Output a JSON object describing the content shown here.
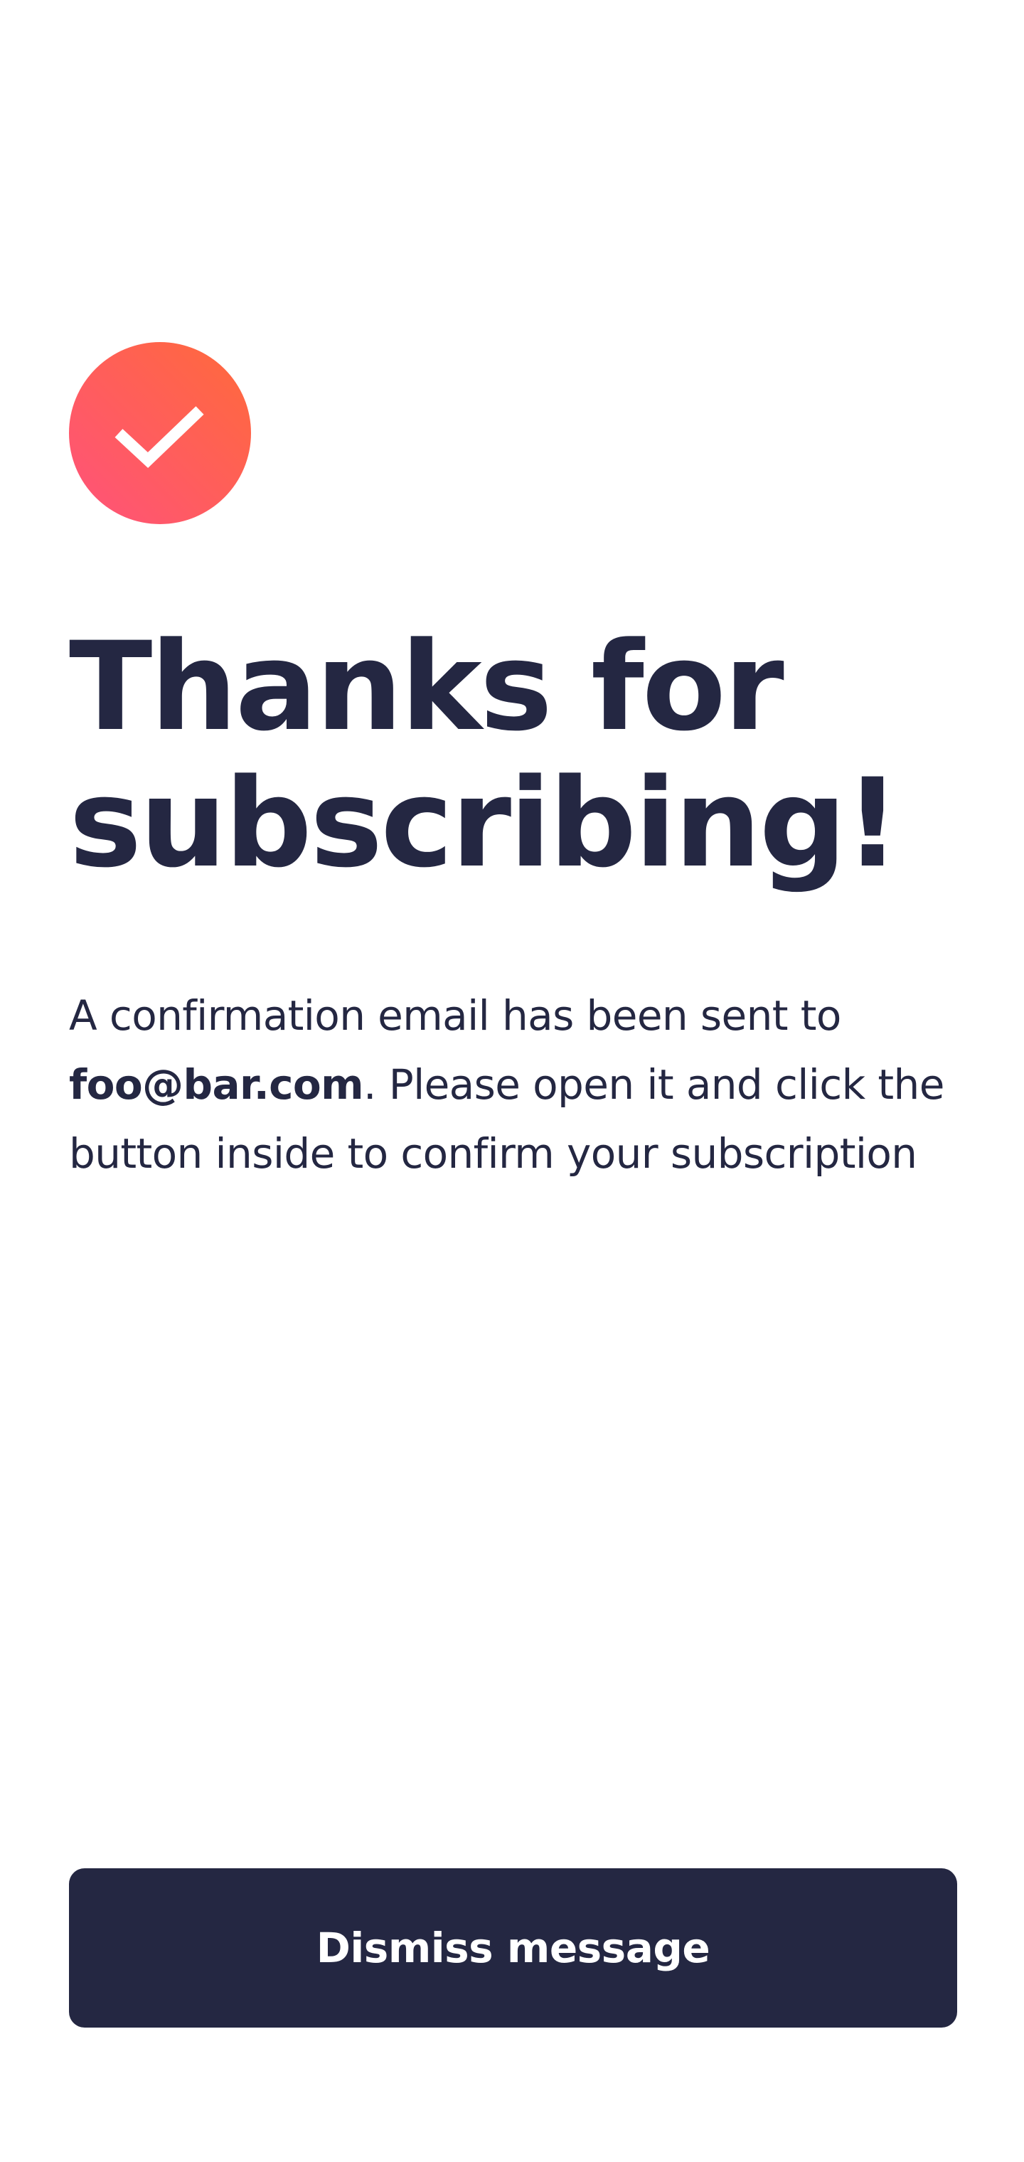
{
  "icon": {
    "name": "checkmark-icon",
    "gradient_from": "#ff527b",
    "gradient_to": "#ff6a3a"
  },
  "title": {
    "line1": "Thanks for",
    "line2": "subscribing!"
  },
  "message": {
    "before_email": "A confirmation email has been sent to",
    "email": "foo@bar.com",
    "after_email": ". Please open it and click the button inside to confirm your subscription"
  },
  "dismiss_button": {
    "label": "Dismiss message",
    "background": "#242742",
    "text_color": "#ffffff"
  },
  "colors": {
    "text": "#242742",
    "background": "#ffffff"
  }
}
